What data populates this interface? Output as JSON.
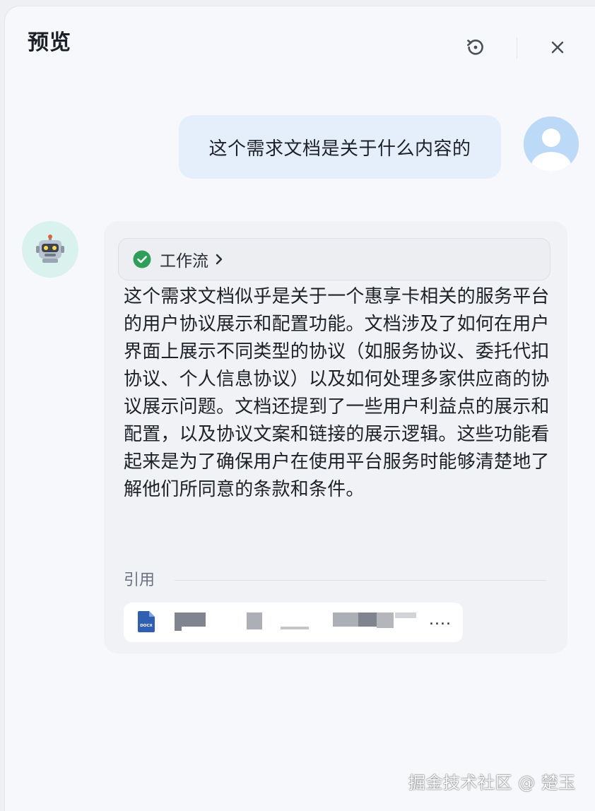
{
  "header": {
    "title": "预览",
    "refresh_icon": "refresh-icon",
    "close_icon": "close-icon"
  },
  "conversation": {
    "user_message": "这个需求文档是关于什么内容的",
    "user_avatar_icon": "user-avatar-icon",
    "bot_avatar_icon": "robot-icon",
    "workflow": {
      "label": "工作流",
      "status_icon": "check-circle-icon",
      "status_color": "#2f9e5a",
      "chevron_icon": "chevron-right-icon"
    },
    "answer": "这个需求文档似乎是关于一个惠享卡相关的服务平台的用户协议展示和配置功能。文档涉及了如何在用户界面上展示不同类型的协议（如服务协议、委托代扣协议、个人信息协议）以及如何处理多家供应商的协议展示问题。文档还提到了一些用户利益点的展示和配置，以及协议文案和链接的展示逻辑。这些功能看起来是为了确保用户在使用平台服务时能够清楚地了解他们所同意的条款和条件。",
    "reference": {
      "label": "引用",
      "file_icon": "docx-file-icon",
      "file_badge": "DOCX",
      "ellipsis": "...."
    }
  },
  "watermark": "掘金技术社区 @ 楚玉"
}
